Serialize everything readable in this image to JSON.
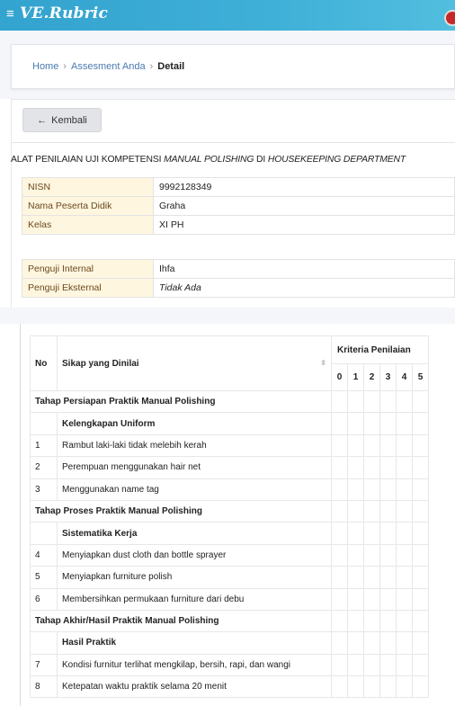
{
  "app": {
    "menu_icon": "≡",
    "brand": "VE.Rubric",
    "avatar_icon": "avatar-icon"
  },
  "breadcrumb": {
    "home": "Home",
    "assessment": "Assesment Anda",
    "current": "Detail",
    "separator": "›"
  },
  "back_button": {
    "arrow": "←",
    "label": "Kembali"
  },
  "title": {
    "part1": "ALAT PENILAIAN UJI KOMPETENSI ",
    "part2": "MANUAL POLISHING",
    "part3": " DI ",
    "part4": "HOUSEKEEPING DEPARTMENT"
  },
  "student": [
    {
      "label": "NISN",
      "value": "9992128349"
    },
    {
      "label": "Nama Peserta Didik",
      "value": "Graha"
    },
    {
      "label": "Kelas",
      "value": "XI PH"
    }
  ],
  "examiners": [
    {
      "label": "Penguji Internal",
      "value": "Ihfa"
    },
    {
      "label": "Penguji Eksternal",
      "value": "Tidak Ada"
    }
  ],
  "rubric": {
    "headers": {
      "no": "No",
      "attribute": "Sikap yang Dinilai",
      "criteria": "Kriteria Penilaian",
      "sort_icon": "⬍"
    },
    "scores": [
      "0",
      "1",
      "2",
      "3",
      "4",
      "5"
    ],
    "rows": [
      {
        "type": "stage",
        "text": "Tahap Persiapan Praktik Manual Polishing"
      },
      {
        "type": "sub",
        "text": "Kelengkapan Uniform"
      },
      {
        "type": "item",
        "no": "1",
        "text": "Rambut laki-laki tidak melebih kerah"
      },
      {
        "type": "item",
        "no": "2",
        "text": "Perempuan menggunakan hair net"
      },
      {
        "type": "item",
        "no": "3",
        "text": "Menggunakan name tag"
      },
      {
        "type": "stage",
        "text": "Tahap Proses Praktik Manual Polishing"
      },
      {
        "type": "sub",
        "text": "Sistematika Kerja"
      },
      {
        "type": "item",
        "no": "4",
        "text": "Menyiapkan dust cloth dan bottle sprayer"
      },
      {
        "type": "item",
        "no": "5",
        "text": "Menyiapkan furniture polish"
      },
      {
        "type": "item",
        "no": "6",
        "text": "Membersihkan permukaan furniture dari debu"
      },
      {
        "type": "stage",
        "text": "Tahap Akhir/Hasil Praktik Manual Polishing"
      },
      {
        "type": "sub",
        "text": "Hasil Praktik"
      },
      {
        "type": "item",
        "no": "7",
        "text": "Kondisi furnitur terlihat mengkilap, bersih, rapi, dan wangi"
      },
      {
        "type": "item",
        "no": "8",
        "text": "Ketepatan waktu praktik selama 20 menit"
      }
    ]
  }
}
